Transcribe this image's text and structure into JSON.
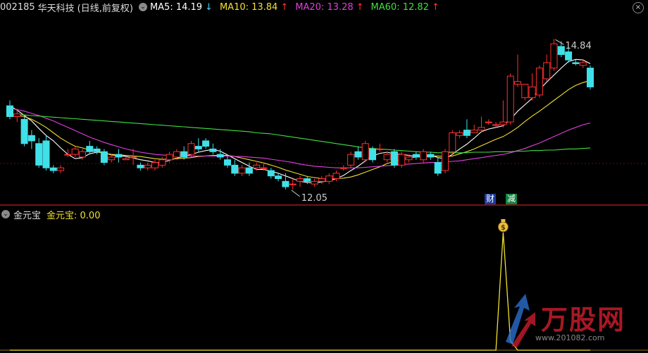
{
  "header": {
    "code": "002185",
    "name": "华天科技",
    "period": "(日线,前复权)",
    "ma5_label": "MA5: 14.19",
    "ma5_arrow": "↓",
    "ma10_label": "MA10: 13.84",
    "ma10_arrow": "↑",
    "ma20_label": "MA20: 13.28",
    "ma20_arrow": "↑",
    "ma60_label": "MA60: 12.82",
    "ma60_arrow": "↑",
    "close_symbol": "×"
  },
  "indicator": {
    "name": "金元宝",
    "value_label": "金元宝: 0.00"
  },
  "badges": {
    "cai": "财",
    "jian": "减"
  },
  "watermark": {
    "title": "万股网",
    "url": "www.201082.com"
  },
  "colors": {
    "up": "#ff3030",
    "down": "#40e0e8",
    "ma5": "#ffffff",
    "ma10": "#f0e030",
    "ma20": "#e040e0",
    "ma60": "#40e040",
    "indicator": "#f0e030"
  },
  "chart_data": [
    {
      "type": "candlestick",
      "title": "002185 华天科技 (日线,前复权)",
      "ylim": [
        11.8,
        15.3
      ],
      "annotations": [
        {
          "text": "14.84",
          "value": 14.84,
          "label": "high"
        },
        {
          "text": "12.05",
          "value": 12.05,
          "label": "low"
        }
      ],
      "candles": [
        [
          13.6,
          13.7,
          13.35,
          13.4
        ],
        [
          13.4,
          13.55,
          13.3,
          13.45
        ],
        [
          13.35,
          13.4,
          12.85,
          12.9
        ],
        [
          13.05,
          13.15,
          12.8,
          12.95
        ],
        [
          12.9,
          13.0,
          12.45,
          12.5
        ],
        [
          12.95,
          13.05,
          12.4,
          12.45
        ],
        [
          12.45,
          12.5,
          12.35,
          12.4
        ],
        [
          12.4,
          12.5,
          12.35,
          12.45
        ],
        [
          12.7,
          12.8,
          12.65,
          12.7
        ],
        [
          12.7,
          12.85,
          12.65,
          12.8
        ],
        [
          12.65,
          12.8,
          12.6,
          12.75
        ],
        [
          12.85,
          12.95,
          12.7,
          12.75
        ],
        [
          12.8,
          12.85,
          12.7,
          12.75
        ],
        [
          12.75,
          12.8,
          12.5,
          12.55
        ],
        [
          12.6,
          12.7,
          12.55,
          12.65
        ],
        [
          12.7,
          12.8,
          12.55,
          12.65
        ],
        [
          12.6,
          12.65,
          12.6,
          12.62
        ],
        [
          12.65,
          12.8,
          12.5,
          12.65
        ],
        [
          12.5,
          12.55,
          12.4,
          12.45
        ],
        [
          12.45,
          12.55,
          12.4,
          12.5
        ],
        [
          12.45,
          12.6,
          12.4,
          12.55
        ],
        [
          12.5,
          12.65,
          12.45,
          12.6
        ],
        [
          12.6,
          12.75,
          12.55,
          12.7
        ],
        [
          12.65,
          12.8,
          12.6,
          12.75
        ],
        [
          12.75,
          12.85,
          12.6,
          12.65
        ],
        [
          12.7,
          12.95,
          12.65,
          12.9
        ],
        [
          12.85,
          13.0,
          12.75,
          12.8
        ],
        [
          12.95,
          13.0,
          12.8,
          12.85
        ],
        [
          12.8,
          12.9,
          12.7,
          12.75
        ],
        [
          12.7,
          12.8,
          12.6,
          12.65
        ],
        [
          12.6,
          12.7,
          12.45,
          12.5
        ],
        [
          12.5,
          12.6,
          12.3,
          12.35
        ],
        [
          12.35,
          12.5,
          12.3,
          12.45
        ],
        [
          12.45,
          12.55,
          12.3,
          12.35
        ],
        [
          12.45,
          12.55,
          12.4,
          12.5
        ],
        [
          12.45,
          12.55,
          12.4,
          12.45
        ],
        [
          12.4,
          12.45,
          12.25,
          12.3
        ],
        [
          12.3,
          12.35,
          12.2,
          12.25
        ],
        [
          12.2,
          12.35,
          12.05,
          12.1
        ],
        [
          12.15,
          12.25,
          12.05,
          12.15
        ],
        [
          12.2,
          12.3,
          12.1,
          12.25
        ],
        [
          12.25,
          12.3,
          12.15,
          12.2
        ],
        [
          12.15,
          12.25,
          12.1,
          12.2
        ],
        [
          12.2,
          12.3,
          12.15,
          12.25
        ],
        [
          12.2,
          12.35,
          12.15,
          12.3
        ],
        [
          12.25,
          12.4,
          12.2,
          12.35
        ],
        [
          12.45,
          12.5,
          12.4,
          12.45
        ],
        [
          12.5,
          12.75,
          12.45,
          12.7
        ],
        [
          12.75,
          12.85,
          12.6,
          12.65
        ],
        [
          12.6,
          12.95,
          12.55,
          12.9
        ],
        [
          12.8,
          12.85,
          12.55,
          12.6
        ],
        [
          12.8,
          12.9,
          12.75,
          12.8
        ],
        [
          12.6,
          12.75,
          12.55,
          12.7
        ],
        [
          12.75,
          12.8,
          12.45,
          12.5
        ],
        [
          12.5,
          12.75,
          12.45,
          12.7
        ],
        [
          12.6,
          12.7,
          12.55,
          12.65
        ],
        [
          12.7,
          12.75,
          12.6,
          12.65
        ],
        [
          12.6,
          12.8,
          12.55,
          12.75
        ],
        [
          12.7,
          12.75,
          12.6,
          12.65
        ],
        [
          12.55,
          12.65,
          12.3,
          12.35
        ],
        [
          12.4,
          12.8,
          12.35,
          12.75
        ],
        [
          12.75,
          13.15,
          12.7,
          13.1
        ],
        [
          13.05,
          13.15,
          13.0,
          13.1
        ],
        [
          13.15,
          13.35,
          13.0,
          13.05
        ],
        [
          13.1,
          13.25,
          13.1,
          13.15
        ],
        [
          13.15,
          13.4,
          13.1,
          13.2
        ],
        [
          13.3,
          13.35,
          13.25,
          13.3
        ],
        [
          13.25,
          13.3,
          13.2,
          13.25
        ],
        [
          13.25,
          13.7,
          13.2,
          13.3
        ],
        [
          13.3,
          14.2,
          13.25,
          14.15
        ],
        [
          14.0,
          14.55,
          13.95,
          14.05
        ],
        [
          13.75,
          14.0,
          13.7,
          14.0
        ],
        [
          13.75,
          14.2,
          13.7,
          13.95
        ],
        [
          13.8,
          14.35,
          13.75,
          14.3
        ],
        [
          14.1,
          14.55,
          14.05,
          14.4
        ],
        [
          14.3,
          14.84,
          14.25,
          14.75
        ],
        [
          14.7,
          14.8,
          14.5,
          14.55
        ],
        [
          14.6,
          14.7,
          14.4,
          14.45
        ],
        [
          14.4,
          14.45,
          14.35,
          14.38
        ],
        [
          14.35,
          14.45,
          14.3,
          14.4
        ],
        [
          14.3,
          14.35,
          13.9,
          13.95
        ]
      ],
      "ma_series": [
        {
          "name": "MA5",
          "start": 0,
          "values": [
            13.6,
            13.52,
            13.42,
            13.32,
            13.18,
            13.05,
            12.95,
            12.82,
            12.7,
            12.62,
            12.64,
            12.71,
            12.74,
            12.73,
            12.69,
            12.68,
            12.66,
            12.63,
            12.6,
            12.58,
            12.55,
            12.55,
            12.59,
            12.63,
            12.66,
            12.7,
            12.74,
            12.77,
            12.79,
            12.76,
            12.69,
            12.62,
            12.55,
            12.48,
            12.42,
            12.42,
            12.39,
            12.35,
            12.3,
            12.25,
            12.2,
            12.18,
            12.17,
            12.19,
            12.21,
            12.25,
            12.31,
            12.4,
            12.48,
            12.58,
            12.67,
            12.72,
            12.74,
            12.71,
            12.7,
            12.68,
            12.66,
            12.68,
            12.69,
            12.64,
            12.62,
            12.7,
            12.8,
            12.89,
            13.0,
            13.12,
            13.17,
            13.2,
            13.23,
            13.35,
            13.5,
            13.62,
            13.74,
            13.9,
            14.04,
            14.17,
            14.3,
            14.42,
            14.46,
            14.45,
            14.38
          ]
        },
        {
          "name": "MA10",
          "start": 0,
          "values": [
            13.4,
            13.42,
            13.4,
            13.35,
            13.28,
            13.2,
            13.1,
            13.0,
            12.92,
            12.85,
            12.82,
            12.78,
            12.75,
            12.72,
            12.7,
            12.69,
            12.68,
            12.67,
            12.66,
            12.64,
            12.62,
            12.61,
            12.61,
            12.62,
            12.63,
            12.64,
            12.66,
            12.67,
            12.68,
            12.68,
            12.68,
            12.66,
            12.63,
            12.6,
            12.57,
            12.54,
            12.5,
            12.46,
            12.41,
            12.37,
            12.33,
            12.29,
            12.27,
            12.25,
            12.24,
            12.25,
            12.26,
            12.28,
            12.32,
            12.37,
            12.42,
            12.47,
            12.53,
            12.57,
            12.61,
            12.63,
            12.65,
            12.66,
            12.67,
            12.67,
            12.66,
            12.67,
            12.71,
            12.75,
            12.8,
            12.86,
            12.92,
            12.98,
            13.03,
            13.11,
            13.2,
            13.31,
            13.41,
            13.5,
            13.6,
            13.7,
            13.8,
            13.9,
            13.98,
            14.03,
            14.07
          ]
        },
        {
          "name": "MA20",
          "start": 0,
          "values": [
            13.55,
            13.53,
            13.5,
            13.46,
            13.42,
            13.37,
            13.32,
            13.26,
            13.2,
            13.14,
            13.08,
            13.02,
            12.97,
            12.92,
            12.88,
            12.84,
            12.8,
            12.77,
            12.74,
            12.72,
            12.7,
            12.69,
            12.68,
            12.68,
            12.68,
            12.67,
            12.67,
            12.67,
            12.67,
            12.67,
            12.67,
            12.66,
            12.66,
            12.65,
            12.64,
            12.63,
            12.61,
            12.59,
            12.57,
            12.55,
            12.52,
            12.5,
            12.48,
            12.47,
            12.46,
            12.45,
            12.45,
            12.45,
            12.45,
            12.46,
            12.47,
            12.48,
            12.49,
            12.5,
            12.51,
            12.52,
            12.53,
            12.54,
            12.55,
            12.55,
            12.56,
            12.57,
            12.58,
            12.6,
            12.62,
            12.64,
            12.66,
            12.68,
            12.7,
            12.73,
            12.77,
            12.81,
            12.86,
            12.91,
            12.97,
            13.03,
            13.09,
            13.15,
            13.2,
            13.25,
            13.28
          ]
        },
        {
          "name": "MA60",
          "start": 0,
          "values": [
            13.45,
            13.44,
            13.43,
            13.42,
            13.41,
            13.4,
            13.39,
            13.38,
            13.37,
            13.36,
            13.35,
            13.34,
            13.33,
            13.32,
            13.31,
            13.3,
            13.29,
            13.28,
            13.27,
            13.26,
            13.25,
            13.24,
            13.23,
            13.22,
            13.21,
            13.2,
            13.19,
            13.18,
            13.17,
            13.16,
            13.15,
            13.14,
            13.13,
            13.12,
            13.1,
            13.09,
            13.08,
            13.06,
            13.04,
            13.02,
            13.0,
            12.98,
            12.96,
            12.94,
            12.92,
            12.9,
            12.88,
            12.86,
            12.84,
            12.82,
            12.81,
            12.8,
            12.79,
            12.78,
            12.77,
            12.76,
            12.75,
            12.74,
            12.74,
            12.73,
            12.73,
            12.73,
            12.73,
            12.73,
            12.74,
            12.74,
            12.74,
            12.75,
            12.75,
            12.75,
            12.76,
            12.76,
            12.77,
            12.77,
            12.78,
            12.78,
            12.79,
            12.8,
            12.8,
            12.81,
            12.82
          ]
        }
      ]
    },
    {
      "type": "line",
      "title": "金元宝",
      "series": [
        {
          "name": "金元宝",
          "values": [
            0,
            0,
            0,
            0,
            0,
            0,
            0,
            0,
            0,
            0,
            0,
            0,
            0,
            0,
            0,
            0,
            0,
            0,
            0,
            0,
            0,
            0,
            0,
            0,
            0,
            0,
            0,
            0,
            0,
            0,
            0,
            0,
            0,
            0,
            0,
            0,
            0,
            0,
            0,
            0,
            0,
            0,
            0,
            0,
            0,
            0,
            0,
            0,
            0,
            0,
            0,
            0,
            0,
            0,
            0,
            0,
            0,
            0,
            0,
            0,
            0,
            0,
            0,
            0,
            0,
            0,
            0,
            0,
            1,
            0.08,
            0,
            0,
            0,
            0,
            0,
            0,
            0,
            0,
            0,
            0,
            0
          ]
        }
      ],
      "markers": [
        {
          "index": 68,
          "icon": "money-bag-icon"
        }
      ]
    }
  ]
}
